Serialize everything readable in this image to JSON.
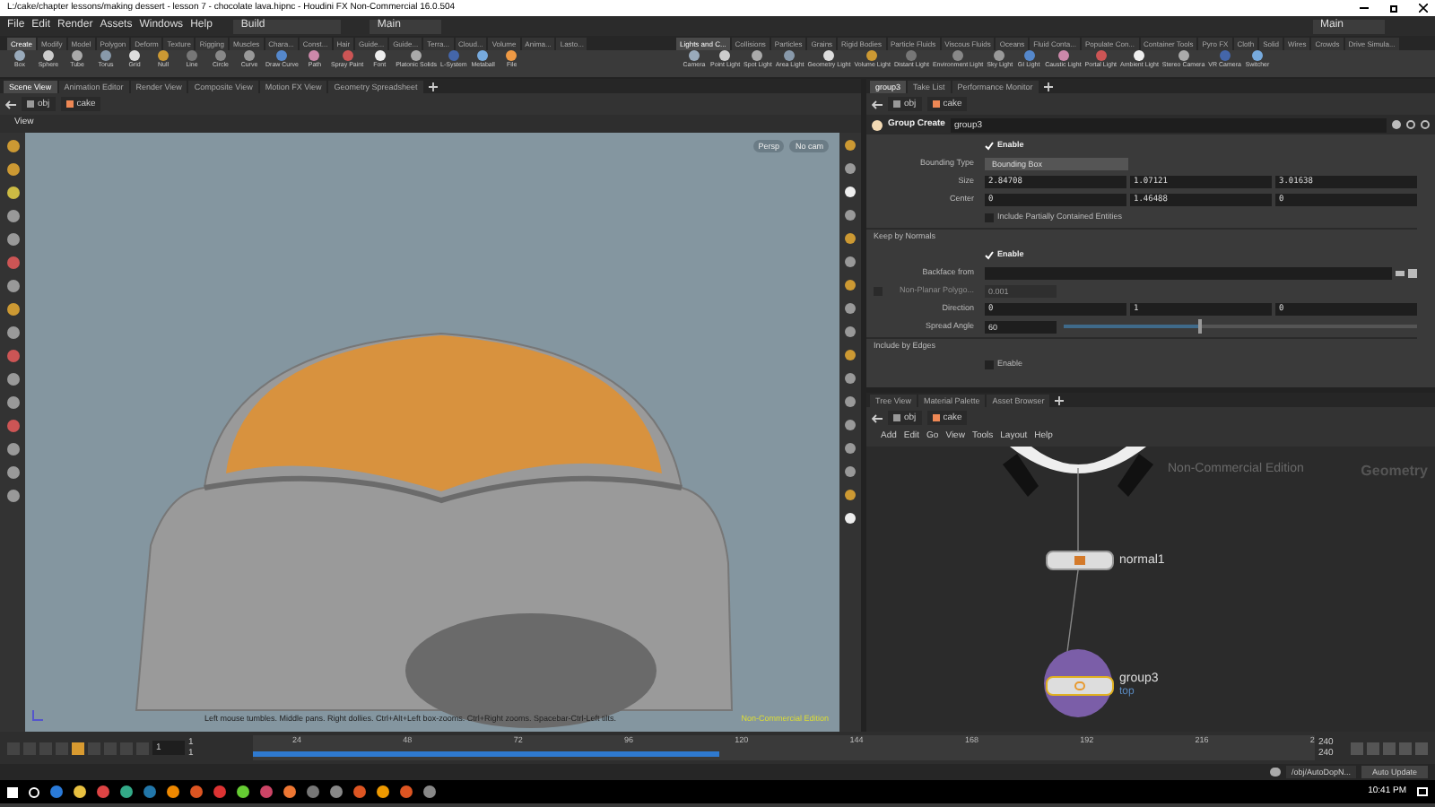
{
  "window": {
    "title": "L:/cake/chapter lessons/making dessert - lesson 7 - chocolate lava.hipnc - Houdini FX Non-Commercial 16.0.504"
  },
  "menu_bar": {
    "items": [
      "File",
      "Edit",
      "Render",
      "Assets",
      "Windows",
      "Help"
    ],
    "desktop": "Build",
    "main_menu": "Main",
    "right_menu": "Main"
  },
  "shelf_tabs_left": [
    {
      "label": "Create",
      "selected": true
    },
    {
      "label": "Modify",
      "selected": false
    },
    {
      "label": "Model",
      "selected": false
    },
    {
      "label": "Polygon",
      "selected": false
    },
    {
      "label": "Deform",
      "selected": false
    },
    {
      "label": "Texture",
      "selected": false
    },
    {
      "label": "Rigging",
      "selected": false
    },
    {
      "label": "Muscles",
      "selected": false
    },
    {
      "label": "Chara...",
      "selected": false
    },
    {
      "label": "Const...",
      "selected": false
    },
    {
      "label": "Hair",
      "selected": false
    },
    {
      "label": "Guide...",
      "selected": false
    },
    {
      "label": "Guide...",
      "selected": false
    },
    {
      "label": "Terra...",
      "selected": false
    },
    {
      "label": "Cloud...",
      "selected": false
    },
    {
      "label": "Volume",
      "selected": false
    },
    {
      "label": "Anima...",
      "selected": false
    },
    {
      "label": "Lasto...",
      "selected": false
    }
  ],
  "shelf_tabs_right": [
    {
      "label": "Lights and C...",
      "selected": true
    },
    {
      "label": "Collisions",
      "selected": false
    },
    {
      "label": "Particles",
      "selected": false
    },
    {
      "label": "Grains",
      "selected": false
    },
    {
      "label": "Rigid Bodies",
      "selected": false
    },
    {
      "label": "Particle Fluids",
      "selected": false
    },
    {
      "label": "Viscous Fluids",
      "selected": false
    },
    {
      "label": "Oceans",
      "selected": false
    },
    {
      "label": "Fluid Conta...",
      "selected": false
    },
    {
      "label": "Populate Con...",
      "selected": false
    },
    {
      "label": "Container Tools",
      "selected": false
    },
    {
      "label": "Pyro FX",
      "selected": false
    },
    {
      "label": "Cloth",
      "selected": false
    },
    {
      "label": "Solid",
      "selected": false
    },
    {
      "label": "Wires",
      "selected": false
    },
    {
      "label": "Crowds",
      "selected": false
    },
    {
      "label": "Drive Simula...",
      "selected": false
    }
  ],
  "shelf_tools_left": [
    "Box",
    "Sphere",
    "Tube",
    "Torus",
    "Grid",
    "Null",
    "Line",
    "Circle",
    "Curve",
    "Draw Curve",
    "Path",
    "Spray Paint",
    "Font",
    "Platonic Solids",
    "L-System",
    "Metaball",
    "File"
  ],
  "shelf_tools_right": [
    "Camera",
    "Point Light",
    "Spot Light",
    "Area Light",
    "Geometry Light",
    "Volume Light",
    "Distant Light",
    "Environment Light",
    "Sky Light",
    "GI Light",
    "Caustic Light",
    "Portal Light",
    "Ambient Light",
    "Stereo Camera",
    "VR Camera",
    "Switcher"
  ],
  "scene_pane": {
    "tabs": [
      {
        "label": "Scene View",
        "selected": true
      },
      {
        "label": "Animation Editor",
        "selected": false
      },
      {
        "label": "Render View",
        "selected": false
      },
      {
        "label": "Composite View",
        "selected": false
      },
      {
        "label": "Motion FX View",
        "selected": false
      },
      {
        "label": "Geometry Spreadsheet",
        "selected": false
      }
    ],
    "path": [
      "obj",
      "cake"
    ],
    "header": "View",
    "viewport": {
      "projection": "Persp",
      "camera": "No cam",
      "hint": "Left mouse tumbles. Middle pans. Right dollies. Ctrl+Alt+Left box-zooms. Ctrl+Right zooms. Spacebar-Ctrl-Left tilts.",
      "edition": "Non-Commercial Edition"
    }
  },
  "parameter_pane": {
    "tabs": [
      {
        "label": "group3",
        "selected": true
      },
      {
        "label": "Take List",
        "selected": false
      },
      {
        "label": "Performance Monitor",
        "selected": false
      }
    ],
    "path": [
      "obj",
      "cake"
    ],
    "node_type": "Group Create",
    "node_name": "group3",
    "parameters": [
      {
        "kind": "checkbox",
        "label": "Enable",
        "checked": true
      },
      {
        "kind": "dropdown",
        "label": "Bounding Type",
        "value": "Bounding Box"
      },
      {
        "kind": "vector",
        "label": "Size",
        "values": [
          "2.84708",
          "1.07121",
          "3.01638"
        ]
      },
      {
        "kind": "vector",
        "label": "Center",
        "values": [
          "0",
          "1.46488",
          "0"
        ]
      },
      {
        "kind": "checkbox",
        "label": "Include Partially Contained Entities",
        "checked": false
      },
      {
        "kind": "section",
        "label": "Keep by Normals"
      },
      {
        "kind": "checkbox",
        "label": "Enable",
        "checked": true
      },
      {
        "kind": "field",
        "label": "Backface from"
      },
      {
        "kind": "toggle_field",
        "label": "Non-Planar Polygo...",
        "value": "0.001",
        "disabled": true
      },
      {
        "kind": "vector",
        "label": "Direction",
        "values": [
          "0",
          "1",
          "0"
        ]
      },
      {
        "kind": "slider",
        "label": "Spread Angle",
        "value": "60",
        "level": 0.38
      },
      {
        "kind": "section",
        "label": "Include by Edges"
      },
      {
        "kind": "checkbox",
        "label": "Enable",
        "checked": false
      }
    ]
  },
  "network_pane": {
    "tabs": [
      {
        "label": "Tree View",
        "selected": false
      },
      {
        "label": "Material Palette",
        "selected": false
      },
      {
        "label": "Asset Browser",
        "selected": false
      }
    ],
    "path": [
      "obj",
      "cake"
    ],
    "menu": [
      "Add",
      "Edit",
      "Go",
      "View",
      "Tools",
      "Layout",
      "Help"
    ],
    "edition": "Non-Commercial Edition",
    "context": "Geometry",
    "nodes": [
      {
        "name": "normal1",
        "selected": false
      },
      {
        "name": "group3",
        "selected": true,
        "flag": "top"
      }
    ]
  },
  "timeline": {
    "frame": "1",
    "range_start": [
      "1",
      "1"
    ],
    "ticks": [
      "24",
      "48",
      "72",
      "96",
      "120",
      "144",
      "168",
      "192",
      "216",
      "2"
    ],
    "range_end": [
      "240",
      "240"
    ]
  },
  "status_bar": {
    "path": "/obj/AutoDopN...",
    "update": "Auto Update"
  },
  "taskbar": {
    "time": "10:41 PM"
  }
}
